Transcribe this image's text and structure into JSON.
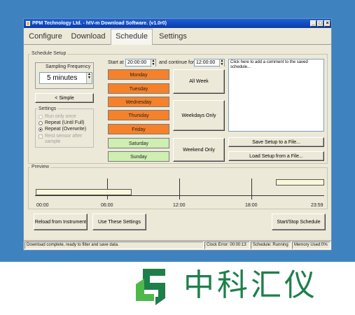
{
  "window": {
    "title": "PPM Technology Ltd. - htV-m Download Software. (v1.0r0)",
    "controls": [
      "_",
      "□",
      "×"
    ]
  },
  "tabs": [
    {
      "label": "Configure"
    },
    {
      "label": "Download"
    },
    {
      "label": "Schedule"
    },
    {
      "label": "Settings"
    }
  ],
  "schedule_setup": {
    "group_label": "Schedule Setup",
    "sampling": {
      "label": "Sampling Frequency",
      "value": "5 minutes"
    },
    "simple_button": "< Simple",
    "settings": {
      "label": "Settings",
      "options": [
        {
          "label": "Run only once",
          "selected": false,
          "enabled": false
        },
        {
          "label": "Repeat (Until Full)",
          "selected": false,
          "enabled": true
        },
        {
          "label": "Repeat (Overwrite)",
          "selected": true,
          "enabled": true
        }
      ],
      "checkbox_label": "Rest sensor after sample"
    },
    "start_at_label": "Start at",
    "start_at_value": "20:00:00",
    "continue_label": "and continue for",
    "continue_value": "12:00:00",
    "days": [
      {
        "label": "Monday",
        "color": "#f5822a"
      },
      {
        "label": "Tuesday",
        "color": "#f5822a"
      },
      {
        "label": "Wednesday",
        "color": "#f5822a"
      },
      {
        "label": "Thursday",
        "color": "#f5822a"
      },
      {
        "label": "Friday",
        "color": "#f5822a"
      },
      {
        "label": "Saturday",
        "color": "#cfeeb1"
      },
      {
        "label": "Sunday",
        "color": "#cfeeb1"
      }
    ],
    "all_week_button": "All Week",
    "weekdays_only_button": "Weekdays Only",
    "weekend_only_button": "Weekend Only",
    "comment_placeholder": "Click here to add a comment to the saved schedule...",
    "save_setup_button": "Save Setup to a File...",
    "load_setup_button": "Load Setup from a File..."
  },
  "preview": {
    "label": "Preview",
    "times": [
      "00:00",
      "06:00",
      "12:00",
      "18:00",
      "23:59"
    ]
  },
  "actions": {
    "reload_button": "Reload from Instrument",
    "use_settings_button": "Use These Settings",
    "start_stop_button": "Start/Stop Schedule"
  },
  "statusbar": {
    "message": "Download complete, ready to filter and save data.",
    "clock_error": "Clock Error: 00:00:13",
    "schedule": "Schedule: Running",
    "memory": "Memory Used:0%"
  },
  "brand": {
    "text": "中科汇仪",
    "primary_color": "#1e7f4a",
    "accent_color": "#4fb84a"
  }
}
